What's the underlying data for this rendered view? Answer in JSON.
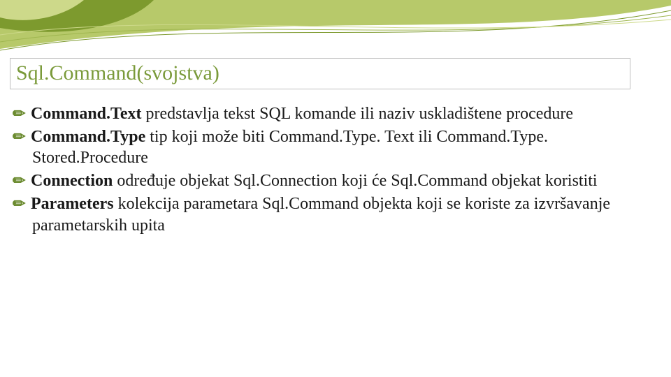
{
  "title": "Sql.Command(svojstva)",
  "bullets": [
    {
      "term": "Command.Text",
      "rest": " predstavlja tekst SQL komande ili naziv uskladištene procedure"
    },
    {
      "term": "Command.Type",
      "rest": " tip koji može biti Command.Type. Text ili Command.Type. Stored.Procedure"
    },
    {
      "term": "Connection",
      "rest": " određuje objekat Sql.Connection koji će Sql.Command objekat koristiti"
    },
    {
      "term": "Parameters",
      "rest": " kolekcija parametara Sql.Command objekta koji se koriste za izvršavanje parametarskih upita"
    }
  ],
  "bullet_glyph": "✏"
}
